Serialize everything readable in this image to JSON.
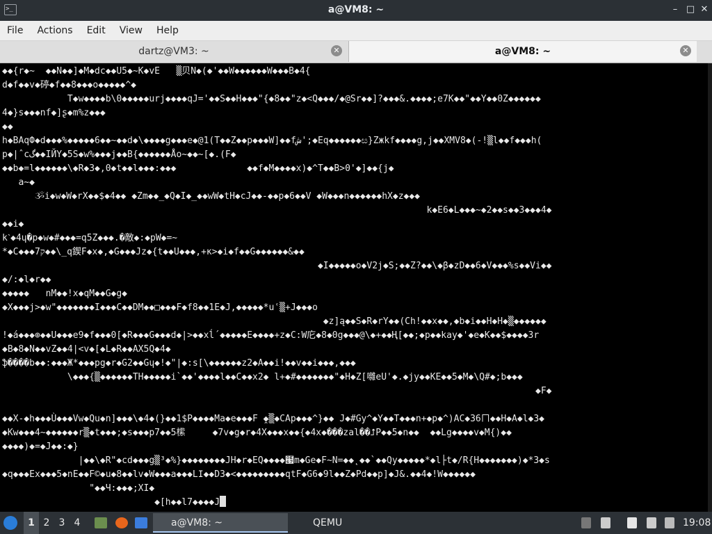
{
  "window": {
    "title": "a@VM8: ~",
    "app_icon": ">_",
    "minimize": "–",
    "maximize": "□",
    "close": "✕"
  },
  "menu": [
    "File",
    "Actions",
    "Edit",
    "View",
    "Help"
  ],
  "tabs": [
    {
      "label": "dartz@VM3: ~",
      "active": false
    },
    {
      "label": "a@VM8: ~",
      "active": true
    }
  ],
  "tab_close_glyph": "✕",
  "terminal_text": "◆◆{r◆~  ◆◆N◆◆]◆M◆dc◆◆U5◆~K◆vE   ▒贝N◆(◆'◆◆W◆◆◆◆◆◆W◆◆◆B◆4{\nd◆f◆◆v◆碠◆f◆◆8◆◆◆o◆◆◆◆◆^◆\n            T◆w◆◆◆◆b\\0◆◆◆◆◆urj◆◆◆◆qJ='◆◆S◆◆H◆◆◆\"{◆8◆◆\"z◆<Q◆◆◆/◆@Sr◆◆]?◆◆◆&.◆◆◆◆;e7K◆◆\"◆◆Y◆◆0Z◆◆◆◆◆◆\n4◆}s◆◆◆nf◆]ʂ◆m%z◆◆◆\n◆◆\nh◆BAqФ◆d◆◆◆%◆◆◆◆◆6◆◆~◆◆d◆\\◆◆◆◆g◆◆◆e◆@1(T◆◆Z◆◆p◆◆◆W]◆◆fش';◆Eq◆◆◆◆◆◆ස}Zжkf◆◆◆◆g,j◆◆XMV8◆(-!▒l◆◆f◆◆◆h(\np◆|ˆcگ◆◆IЙY◆5S◆w%◆◆◆j◆◆B{◆◆◆◆◆◆Åo~◆◆~[◆.(F◆\n◆◆b◆=l◆◆◆◆◆◆\\◆R◆3◆,0◆t◆◆l◆◆◆:◆◆◆             ◆◆f◆M◆◆◆◆x)◆^T◆◆B>0'◆]◆◆{j◆\n   a~◆\n      ૐi◆w◆W◆rX◆◆$◆4◆◆ ◆Zm◆◆_◆Q◆I◆_◆◆wW◆tH◆cJ◆◆-◆◆p◆6◆◆V ◆W◆◆◆n◆◆◆◆◆◆hX◆z◆◆◆\n                                                                              k◆E6◆L◆◆◆~◆2◆◆s◆◆3◆◆◆4◆\n◆◆i◆\nkˋ◆4ɥ�p◆w◆#◆◆◆=q5Z◆◆◆.�敵◆:◆pW◆=~\n*◆C◆◆◆7ק◆◆\\_q鍥F◆x◆,◆G◆◆◆Jz◆{t◆◆U◆◆◆,+κ>◆i◆f◆◆G◆◆◆◆◆◆&◆◆\n                                                          ◆I◆◆◆◆◆o◆V2j◆S;◆◆Z?◆◆\\◆β◆zD◆◆6◆V◆◆◆%s◆◆Vi◆◆\n◆/:◆l◆r◆◆\n◆◆◆◆◆   nM◆◆!x◆qM◆◆G◆g◆\n◆X◆◆◆j>◆w\"◆◆◆◆◆◆◆I◆◆◆C◆◆DM◆◆□◆◆◆F◆f8◆◆1E◆J,◆◆◆◆◆*uʿ▒+J◆◆◆o\n                                                           ◆z]ą◆◆S◆R◆rY◆◆(Ch!◆◆x◆◆,◆b◆i◆◆H◆H◆▒◆◆◆◆◆◆\n!◆á◆◆◆⊕◆◆U◆◆◆e9◆f◆◆◆0[◆R◆◆◆G◆◆◆d◆|>◆◆xĺ´◆◆◆◆◆E◆◆◆◆+z◆C:W庀◆8◆0g◆◆◆@\\◆+◆◆Ң[◆◆;◆p◆◆kay◆'◆e◆K◆◆$◆◆◆◆3r\n◆B◆8◆N◆◆vZ◆◆4|<v◆[◆L◆R◆◆AX5Q◆4◆\nֆ����b◆◆:◆◆◆Ж*◆◆◆pg◆r◆G2◆◆Gɥ◆!◆\"|◆:s[\\◆◆◆◆◆◆z2◆A◆◆i!◆◆v◆◆i◆◆◆,◆◆◆\n            \\◆◆◆{▒◆◆◆◆◆◆TH◆◆◆◆◆i`◆◆'◆◆◆◆l◆◆C◆◆x2◆ l+◆#◆◆◆◆◆◆◆\"◆H◆Z[囃eU'◆.◆jy◆◆KE◆◆5◆M◆\\Q#◆;b◆◆◆\n                                                                                                  ◆F◆\n\n◆◆X-◆h◆◆◆Ù◆◆◆Vw◆Qu◆n]◆◆◆\\◆4◆(}◆◆1$P◆◆◆◆Ma◆e◆◆◆F ̯◆▒◆CAp◆◆◆^}◆◆ J◆#Gy^◆Y◆◆T◆◆◆n+◆p◆^)AC◆36ㄇ◆◆H◆A◆l◆3◆\n◆Kw◆◆◆4~◆◆◆◆◆◆r▒◆t◆◆◆;◆s◆◆◆p7◆◆5橴     ◆7v◆g◆r◆4X◆◆◆x◆◆{◆4x◆���zal��⮥P◆◆5◆n◆◆  ◆◆Lg◆◆◆◆v◆M{)◆◆\n◆◆◆◆)◆=◆J◆◆:◆}\n              |◆◆\\◆R\"◆cd◆◆◆g▒³◆%}◆◆◆◆◆◆◆◆JH◆r◆EQ◆◆◆◆๧m◆Ge◆F~N=◆◆˛◆◆`◆◆Qy◆◆◆◆◆*◆l├t◆/R{H◆◆◆◆◆◆◆)◆*3◆s\n◆q◆◆◆Ex◆◆◆5◆nE◆◆F©◆u◆8◆◆lv◆W◆◆◆a◆◆◆LΙ◆◆D3◆<◆◆◆◆◆◆◆◆◆qtF◆G6◆9l◆◆Z◆Pd◆◆p]◆J&.◆◆4◆!W◆◆◆◆◆◆\n                \"◆◆Ч:◆◆◆;XI◆\n                            ◆[h◆◆l7◆◆◆◆J",
  "taskbar": {
    "workspaces": [
      "1",
      "2",
      "3",
      "4"
    ],
    "active_workspace": "1",
    "tasks": [
      {
        "label": "a@VM8: ~",
        "icon": "terminal-icon"
      },
      {
        "label": "QEMU",
        "icon": "qemu-icon"
      }
    ],
    "clock": "19:08"
  }
}
